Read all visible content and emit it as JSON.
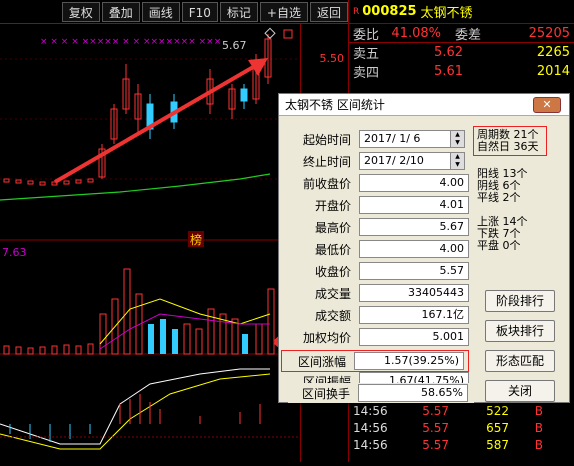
{
  "toolbar": {
    "buttons": [
      "复权",
      "叠加",
      "画线",
      "F10",
      "标记",
      "+自选",
      "返回"
    ]
  },
  "chart": {
    "price_labels": [
      "5.50"
    ],
    "high_marker": "5.67",
    "volume_label": "7.63",
    "badge": "榜"
  },
  "quote": {
    "code": "000825",
    "name": "太钢不锈",
    "header_flag": "R",
    "ratio_label": "委比",
    "ratio_value": "41.08%",
    "diff_label": "委差",
    "diff_value": "25205",
    "asks": [
      {
        "label": "卖五",
        "price": "5.62",
        "vol": "2265"
      },
      {
        "label": "卖四",
        "price": "5.61",
        "vol": "2014"
      }
    ],
    "ticks": [
      {
        "time": "14:56",
        "price": "5.57",
        "vol": "522",
        "bs": "B"
      },
      {
        "time": "14:56",
        "price": "5.57",
        "vol": "657",
        "bs": "B"
      },
      {
        "time": "14:56",
        "price": "5.57",
        "vol": "587",
        "bs": "B"
      }
    ]
  },
  "dialog": {
    "title": "太钢不锈 区间统计",
    "close_label": "关闭",
    "fields": [
      {
        "label": "起始时间",
        "value": "2017/ 1/ 6",
        "kind": "date"
      },
      {
        "label": "终止时间",
        "value": "2017/ 2/10",
        "kind": "date"
      },
      {
        "label": "前收盘价",
        "value": "4.00"
      },
      {
        "label": "开盘价",
        "value": "4.01"
      },
      {
        "label": "最高价",
        "value": "5.67"
      },
      {
        "label": "最低价",
        "value": "4.00"
      },
      {
        "label": "收盘价",
        "value": "5.57"
      },
      {
        "label": "成交量",
        "value": "33405443"
      },
      {
        "label": "成交额",
        "value": "167.1亿"
      },
      {
        "label": "加权均价",
        "value": "5.001"
      },
      {
        "label": "区间涨幅",
        "value": "1.57(39.25%)"
      },
      {
        "label": "区间振幅",
        "value": "1.67(41.75%)"
      },
      {
        "label": "区间换手",
        "value": "58.65%"
      }
    ],
    "period": {
      "l1": "周期数 21个",
      "l2": "自然日 36天"
    },
    "yang": {
      "l1": "阳线 13个",
      "l2": "阴线 6个",
      "l3": "平线 2个"
    },
    "updown": {
      "l1": "上涨 14个",
      "l2": "下跌 7个",
      "l3": "平盘 0个"
    },
    "buttons": [
      "阶段排行",
      "板块排行",
      "形态匹配",
      "关闭"
    ]
  }
}
